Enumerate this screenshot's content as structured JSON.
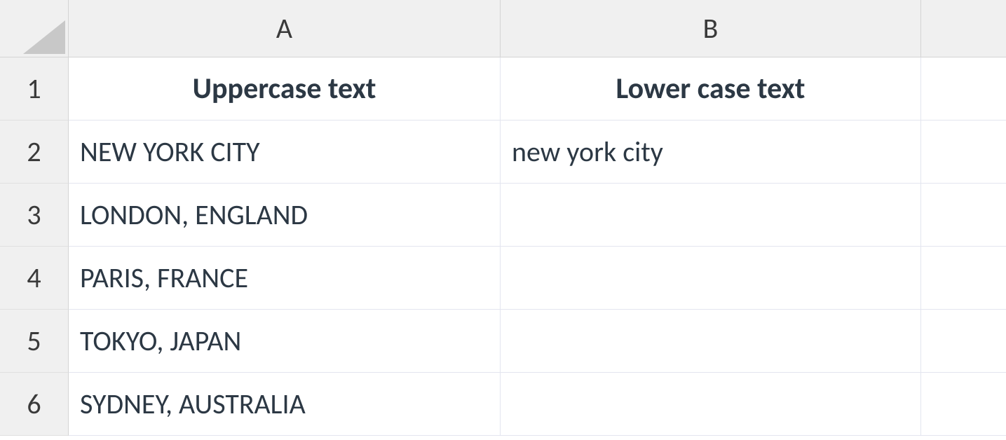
{
  "columns": {
    "A": "A",
    "B": "B"
  },
  "rowNumbers": {
    "r1": "1",
    "r2": "2",
    "r3": "3",
    "r4": "4",
    "r5": "5",
    "r6": "6"
  },
  "headers": {
    "A": "Uppercase text",
    "B": "Lower case text"
  },
  "data": {
    "A2": "NEW YORK CITY",
    "B2": "new york city",
    "A3": "LONDON, ENGLAND",
    "B3": "",
    "A4": "PARIS, FRANCE",
    "B4": "",
    "A5": "TOKYO, JAPAN",
    "B5": "",
    "A6": "SYDNEY, AUSTRALIA",
    "B6": ""
  }
}
